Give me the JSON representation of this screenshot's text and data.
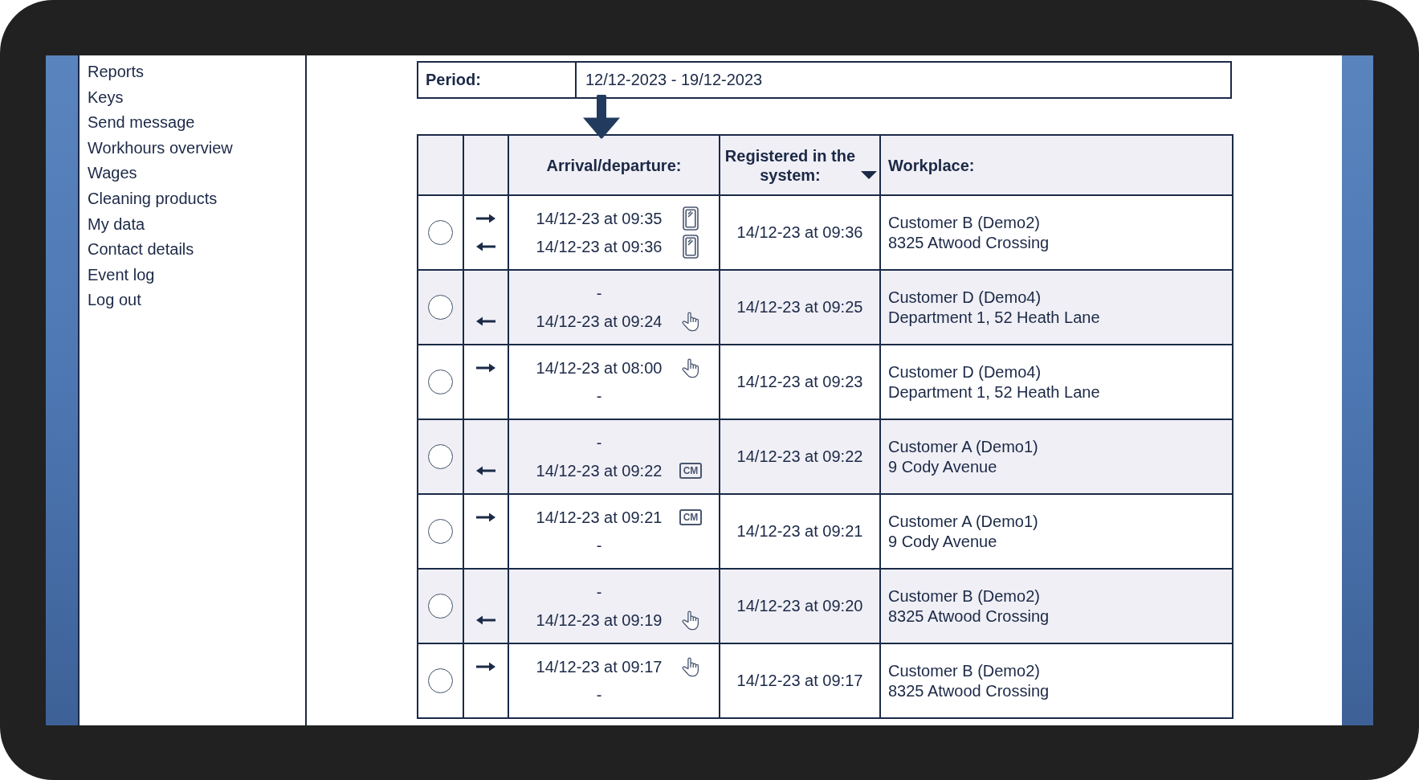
{
  "sidebar": {
    "items": [
      "Reports",
      "Keys",
      "Send message",
      "Workhours overview",
      "Wages",
      "Cleaning products",
      "My data",
      "Contact details",
      "Event log",
      "Log out"
    ]
  },
  "period": {
    "label": "Period:",
    "value": "12/12-2023 - 19/12-2023"
  },
  "table": {
    "columns": [
      {
        "label": "Arrival/departure:",
        "sorted": false
      },
      {
        "label": "Registered in the system:",
        "sorted": true
      },
      {
        "label": "Workplace:",
        "sorted": false
      }
    ],
    "rows": [
      {
        "selected": false,
        "entries": [
          {
            "kind": "phone",
            "text": "14/12-23 at 09:35"
          },
          {
            "kind": "phone",
            "text": "14/12-23 at 09:36"
          }
        ],
        "registered": "14/12-23 at 09:36",
        "workplace": {
          "name": "Customer B (Demo2)",
          "address": "8325 Atwood Crossing"
        }
      },
      {
        "selected": false,
        "entries": [
          {
            "kind": "blank",
            "text": "-"
          },
          {
            "kind": "hand",
            "text": "14/12-23 at 09:24"
          }
        ],
        "registered": "14/12-23 at 09:25",
        "workplace": {
          "name": "Customer D (Demo4)",
          "address": "Department 1, 52 Heath Lane"
        }
      },
      {
        "selected": false,
        "entries": [
          {
            "kind": "hand",
            "text": "14/12-23 at 08:00"
          },
          {
            "kind": "blank",
            "text": "-"
          }
        ],
        "registered": "14/12-23 at 09:23",
        "workplace": {
          "name": "Customer D (Demo4)",
          "address": "Department 1, 52 Heath Lane"
        }
      },
      {
        "selected": false,
        "entries": [
          {
            "kind": "blank",
            "text": "-"
          },
          {
            "kind": "cm",
            "text": "14/12-23 at 09:22",
            "badge": "CM"
          }
        ],
        "registered": "14/12-23 at 09:22",
        "workplace": {
          "name": "Customer A (Demo1)",
          "address": "9 Cody Avenue"
        }
      },
      {
        "selected": false,
        "entries": [
          {
            "kind": "cm",
            "text": "14/12-23 at 09:21",
            "badge": "CM"
          },
          {
            "kind": "blank",
            "text": "-"
          }
        ],
        "registered": "14/12-23 at 09:21",
        "workplace": {
          "name": "Customer A (Demo1)",
          "address": "9 Cody Avenue"
        }
      },
      {
        "selected": false,
        "entries": [
          {
            "kind": "blank",
            "text": "-"
          },
          {
            "kind": "hand",
            "text": "14/12-23 at 09:19"
          }
        ],
        "registered": "14/12-23 at 09:20",
        "workplace": {
          "name": "Customer B (Demo2)",
          "address": "8325 Atwood Crossing"
        }
      },
      {
        "selected": false,
        "entries": [
          {
            "kind": "hand",
            "text": "14/12-23 at 09:17"
          },
          {
            "kind": "blank",
            "text": "-"
          }
        ],
        "registered": "14/12-23 at 09:17",
        "workplace": {
          "name": "Customer B (Demo2)",
          "address": "8325 Atwood Crossing"
        }
      }
    ]
  }
}
